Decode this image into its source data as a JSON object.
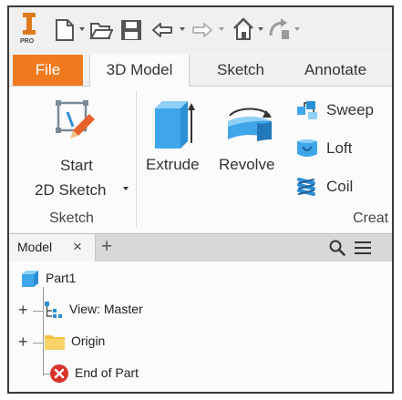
{
  "quick_access": {
    "edition_label": "PRO",
    "icons": [
      "app-logo-icon",
      "new-file-icon",
      "open-folder-icon",
      "save-icon",
      "undo-icon",
      "redo-icon",
      "home-icon",
      "return-icon"
    ]
  },
  "tabs": [
    {
      "label": "File"
    },
    {
      "label": "3D Model"
    },
    {
      "label": "Sketch"
    },
    {
      "label": "Annotate"
    }
  ],
  "ribbon": {
    "start_sketch": {
      "line1": "Start",
      "line2": "2D Sketch"
    },
    "extrude": "Extrude",
    "revolve": "Revolve",
    "sweep": "Sweep",
    "loft": "Loft",
    "coil": "Coil",
    "sketch_panel_label": "Sketch",
    "create_panel_label": "Creat"
  },
  "browser": {
    "tab_label": "Model",
    "close_symbol": "×",
    "add_symbol": "+",
    "tree": [
      {
        "label": "Part1"
      },
      {
        "label": "View: Master"
      },
      {
        "label": "Origin"
      },
      {
        "label": "End of Part"
      }
    ]
  },
  "colors": {
    "file_tab": "#f07a1f",
    "part_blue": "#2b8fd6",
    "folder_yellow": "#f3c443",
    "end_red": "#d8332a"
  }
}
